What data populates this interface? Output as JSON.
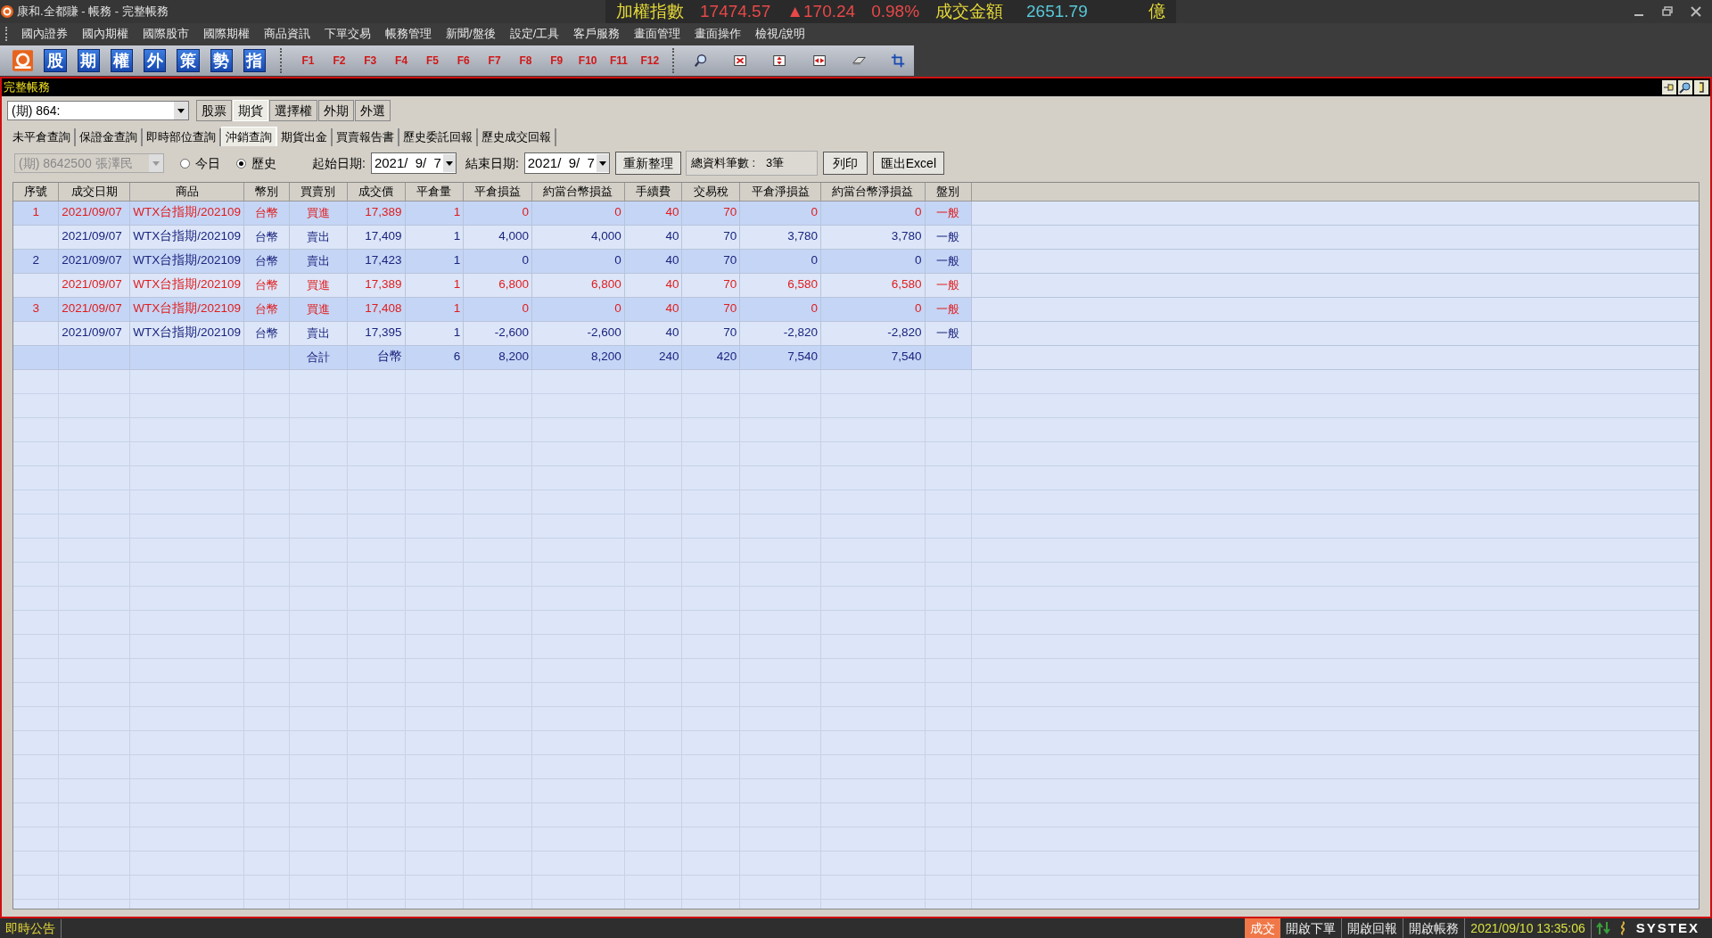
{
  "window": {
    "title": "康和.全都賺 - 帳務 - 完整帳務"
  },
  "ticker": {
    "index_label": "加權指數",
    "index_value": "17474.57",
    "change": "▲170.24",
    "change_pct": "0.98%",
    "turnover_label": "成交金額",
    "turnover_value": "2651.79",
    "turnover_unit": "億"
  },
  "menu": [
    "國內證券",
    "國內期權",
    "國際股市",
    "國際期權",
    "商品資訊",
    "下單交易",
    "帳務管理",
    "新聞/盤後",
    "設定/工具",
    "客戶服務",
    "畫面管理",
    "畫面操作",
    "檢視/說明"
  ],
  "toolbar": {
    "market_buttons": [
      "股",
      "期",
      "權",
      "外",
      "策",
      "勢",
      "指"
    ],
    "function_keys": [
      "F1",
      "F2",
      "F3",
      "F4",
      "F5",
      "F6",
      "F7",
      "F8",
      "F9",
      "F10",
      "F11",
      "F12"
    ]
  },
  "panel": {
    "title": "完整帳務"
  },
  "account": {
    "value": "(期)  864:"
  },
  "market_tabs": [
    {
      "label": "股票",
      "selected": false
    },
    {
      "label": "期貨",
      "selected": true
    },
    {
      "label": "選擇權",
      "selected": false
    },
    {
      "label": "外期",
      "selected": false
    },
    {
      "label": "外選",
      "selected": false
    }
  ],
  "query_tabs": [
    {
      "label": "未平倉查詢",
      "selected": false
    },
    {
      "label": "保證金查詢",
      "selected": false
    },
    {
      "label": "即時部位查詢",
      "selected": false
    },
    {
      "label": "沖銷查詢",
      "selected": true
    },
    {
      "label": "期貨出金",
      "selected": false
    },
    {
      "label": "買賣報告書",
      "selected": false
    },
    {
      "label": "歷史委託回報",
      "selected": false
    },
    {
      "label": "歷史成交回報",
      "selected": false
    }
  ],
  "filter": {
    "account": "(期)  8642500 張澤民",
    "range": [
      {
        "label": "今日",
        "selected": false
      },
      {
        "label": "歷史",
        "selected": true
      }
    ],
    "start_label": "起始日期:",
    "start_date": "2021/  9/  7",
    "end_label": "結束日期:",
    "end_date": "2021/  9/  7",
    "refresh_button": "重新整理",
    "count_label": "總資料筆數 :",
    "count_value": "3筆",
    "print_button": "列印",
    "export_button": "匯出Excel"
  },
  "table": {
    "columns": [
      "序號",
      "成交日期",
      "商品",
      "幣別",
      "買賣別",
      "成交價",
      "平倉量",
      "平倉損益",
      "約當台幣損益",
      "手續費",
      "交易稅",
      "平倉淨損益",
      "約當台幣淨損益",
      "盤別"
    ],
    "rows": [
      {
        "kind": "buy",
        "group_start": true,
        "cells": [
          "1",
          "2021/09/07",
          "WTX台指期/202109",
          "台幣",
          "買進",
          "17,389",
          "1",
          "0",
          "0",
          "40",
          "70",
          "0",
          "0",
          "一般"
        ]
      },
      {
        "kind": "sell",
        "group_start": false,
        "cells": [
          "",
          "2021/09/07",
          "WTX台指期/202109",
          "台幣",
          "賣出",
          "17,409",
          "1",
          "4,000",
          "4,000",
          "40",
          "70",
          "3,780",
          "3,780",
          "一般"
        ]
      },
      {
        "kind": "sell",
        "group_start": true,
        "cells": [
          "2",
          "2021/09/07",
          "WTX台指期/202109",
          "台幣",
          "賣出",
          "17,423",
          "1",
          "0",
          "0",
          "40",
          "70",
          "0",
          "0",
          "一般"
        ]
      },
      {
        "kind": "buy",
        "group_start": false,
        "cells": [
          "",
          "2021/09/07",
          "WTX台指期/202109",
          "台幣",
          "買進",
          "17,389",
          "1",
          "6,800",
          "6,800",
          "40",
          "70",
          "6,580",
          "6,580",
          "一般"
        ]
      },
      {
        "kind": "buy",
        "group_start": true,
        "cells": [
          "3",
          "2021/09/07",
          "WTX台指期/202109",
          "台幣",
          "買進",
          "17,408",
          "1",
          "0",
          "0",
          "40",
          "70",
          "0",
          "0",
          "一般"
        ]
      },
      {
        "kind": "sell",
        "group_start": false,
        "cells": [
          "",
          "2021/09/07",
          "WTX台指期/202109",
          "台幣",
          "賣出",
          "17,395",
          "1",
          "-2,600",
          "-2,600",
          "40",
          "70",
          "-2,820",
          "-2,820",
          "一般"
        ]
      },
      {
        "kind": "total",
        "group_start": true,
        "cells": [
          "",
          "",
          "",
          "",
          "合計",
          "台幣",
          "6",
          "8,200",
          "8,200",
          "240",
          "420",
          "7,540",
          "7,540",
          ""
        ]
      }
    ]
  },
  "status_bar": {
    "notice": "即時公告",
    "fill_button": "成交",
    "buttons": [
      "開啟下單",
      "開啟回報",
      "開啟帳務"
    ],
    "datetime": "2021/09/10 13:35:06",
    "brand": "SYSTEX"
  }
}
